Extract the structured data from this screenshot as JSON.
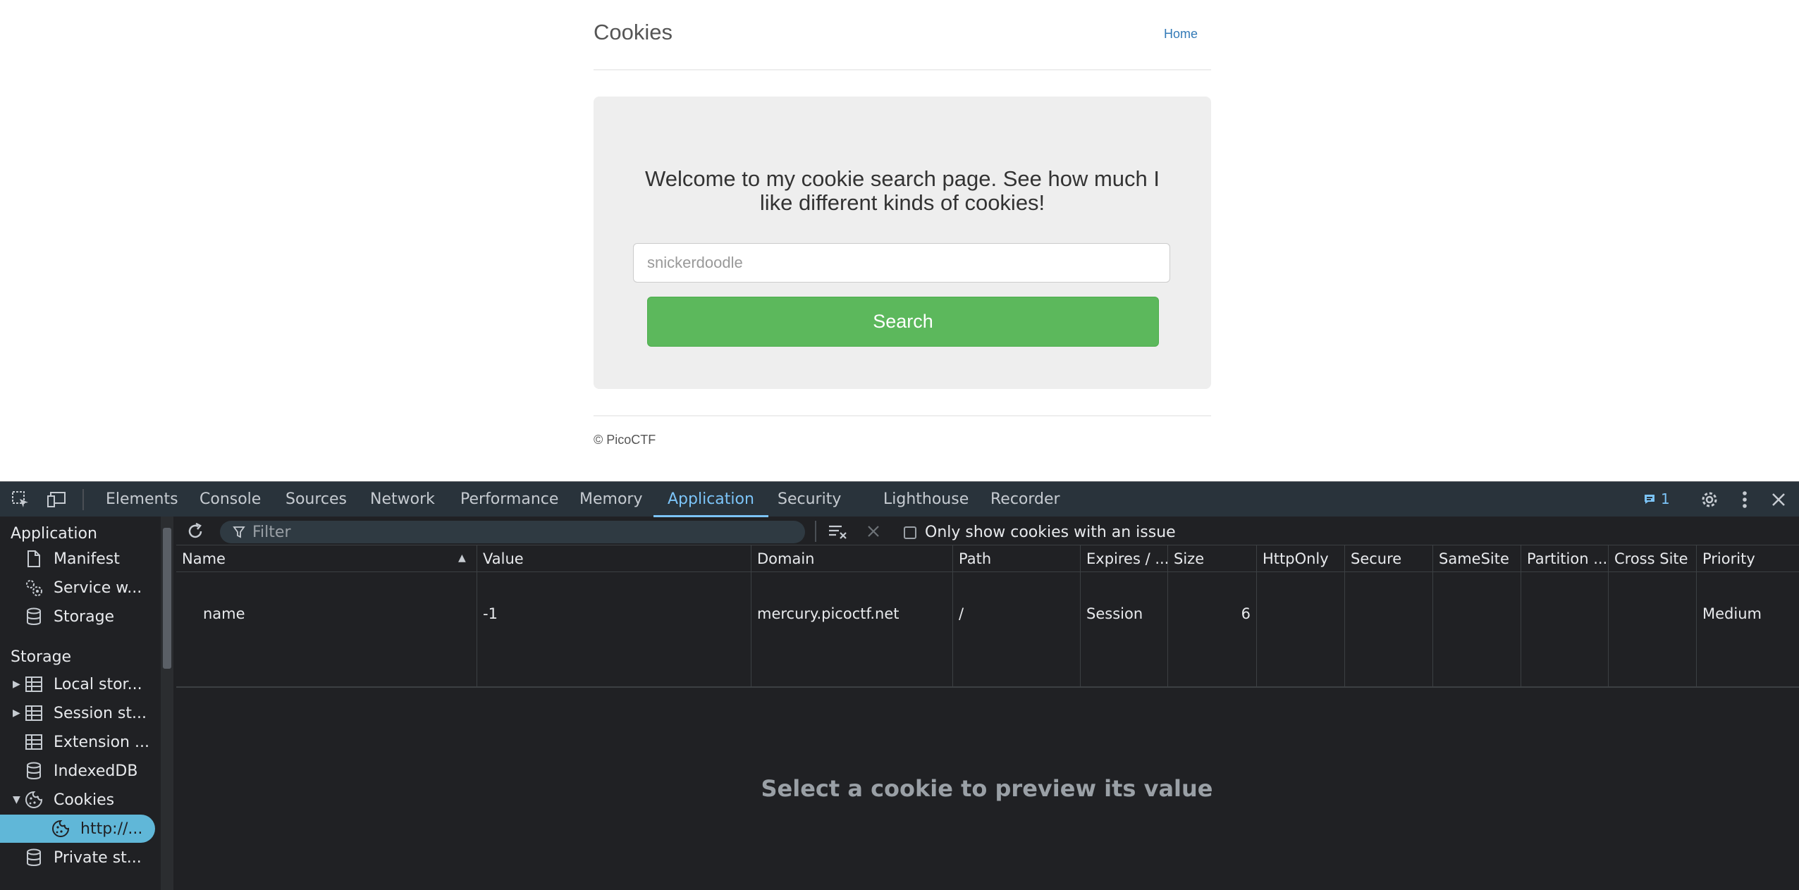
{
  "site": {
    "title": "Cookies",
    "home_link": "Home",
    "welcome": "Welcome to my cookie search page. See how much I like different kinds of cookies!",
    "search_placeholder": "snickerdoodle",
    "search_button": "Search",
    "footer": "© PicoCTF"
  },
  "devtools": {
    "tabs": [
      "Elements",
      "Console",
      "Sources",
      "Network",
      "Performance",
      "Memory",
      "Application",
      "Security",
      "Lighthouse",
      "Recorder"
    ],
    "active_tab": "Application",
    "issues_count": "1",
    "sidebar": {
      "application_heading": "Application",
      "application_items": [
        "Manifest",
        "Service w...",
        "Storage"
      ],
      "storage_heading": "Storage",
      "storage_items": [
        "Local stor...",
        "Session st...",
        "Extension ...",
        "IndexedDB",
        "Cookies",
        "http://...",
        "Private st..."
      ]
    },
    "toolbar": {
      "filter_placeholder": "Filter",
      "only_issues_label": "Only show cookies with an issue"
    },
    "table": {
      "columns": [
        "Name",
        "Value",
        "Domain",
        "Path",
        "Expires / ...",
        "Size",
        "HttpOnly",
        "Secure",
        "SameSite",
        "Partition ...",
        "Cross Site",
        "Priority"
      ],
      "rows": [
        {
          "name": "name",
          "value": "-1",
          "domain": "mercury.picoctf.net",
          "path": "/",
          "expires": "Session",
          "size": "6",
          "httponly": "",
          "secure": "",
          "samesite": "",
          "partition": "",
          "cross_site": "",
          "priority": "Medium"
        }
      ]
    },
    "preview_text": "Select a cookie to preview its value"
  }
}
